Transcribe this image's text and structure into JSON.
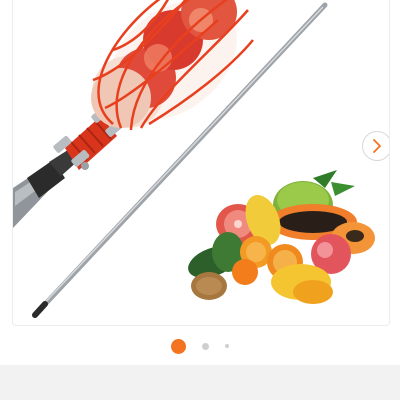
{
  "product_image": {
    "description_icon": "fruit-picker-pole-with-fruit-basket",
    "colors": {
      "basket": "#e8401f",
      "pole": "#9ea3a8",
      "handle": "#2b2b2b",
      "accent": "#f47321"
    }
  },
  "gallery": {
    "next_icon": "chevron-right-icon",
    "page_indicator": {
      "count": 3,
      "active_index": 0
    }
  }
}
